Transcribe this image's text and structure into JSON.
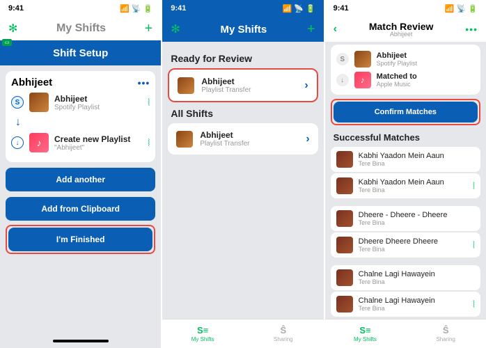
{
  "status_time": "9:41",
  "phone1": {
    "faint_title": "My Shifts",
    "header_title": "Shift Setup",
    "name": "Abhijeet",
    "services": [
      {
        "name": "Abhijeet",
        "sub": "Spotify Playlist"
      },
      {
        "name": "Create new Playlist",
        "sub": "\"Abhijeet\""
      }
    ],
    "btn_add_another": "Add another",
    "btn_add_clipboard": "Add from Clipboard",
    "btn_finished": "I'm Finished"
  },
  "phone2": {
    "header_title": "My Shifts",
    "section_ready": "Ready for Review",
    "section_all": "All Shifts",
    "rows": [
      {
        "title": "Abhijeet",
        "sub": "Playlist Transfer"
      },
      {
        "title": "Abhijeet",
        "sub": "Playlist Transfer"
      }
    ],
    "tab_shifts": "My Shifts",
    "tab_sharing": "Sharing"
  },
  "phone3": {
    "header_title": "Match Review",
    "header_sub": "Abhijeet",
    "src": {
      "name": "Abhijeet",
      "sub": "Spotify Playlist"
    },
    "dst": {
      "name": "Matched to",
      "sub": "Apple Music"
    },
    "btn_confirm": "Confirm Matches",
    "section_success": "Successful Matches",
    "tracks": [
      {
        "title": "Kabhi Yaadon Mein Aaun",
        "sub": "Tere Bina",
        "match": false
      },
      {
        "title": "Kabhi Yaadon Mein Aaun",
        "sub": "Tere Bina",
        "match": true
      },
      {
        "title": "Dheere - Dheere - Dheere",
        "sub": "Tere Bina",
        "match": false
      },
      {
        "title": "Dheere Dheere Dheere",
        "sub": "Tere Bina",
        "match": true
      },
      {
        "title": "Chalne Lagi Hawayein",
        "sub": "Tere Bina",
        "match": false
      },
      {
        "title": "Chalne Lagi Hawayein",
        "sub": "Tere Bina",
        "match": true
      }
    ],
    "tab_shifts": "My Shifts",
    "tab_sharing": "Sharing"
  },
  "chart_data": {
    "type": "table"
  }
}
